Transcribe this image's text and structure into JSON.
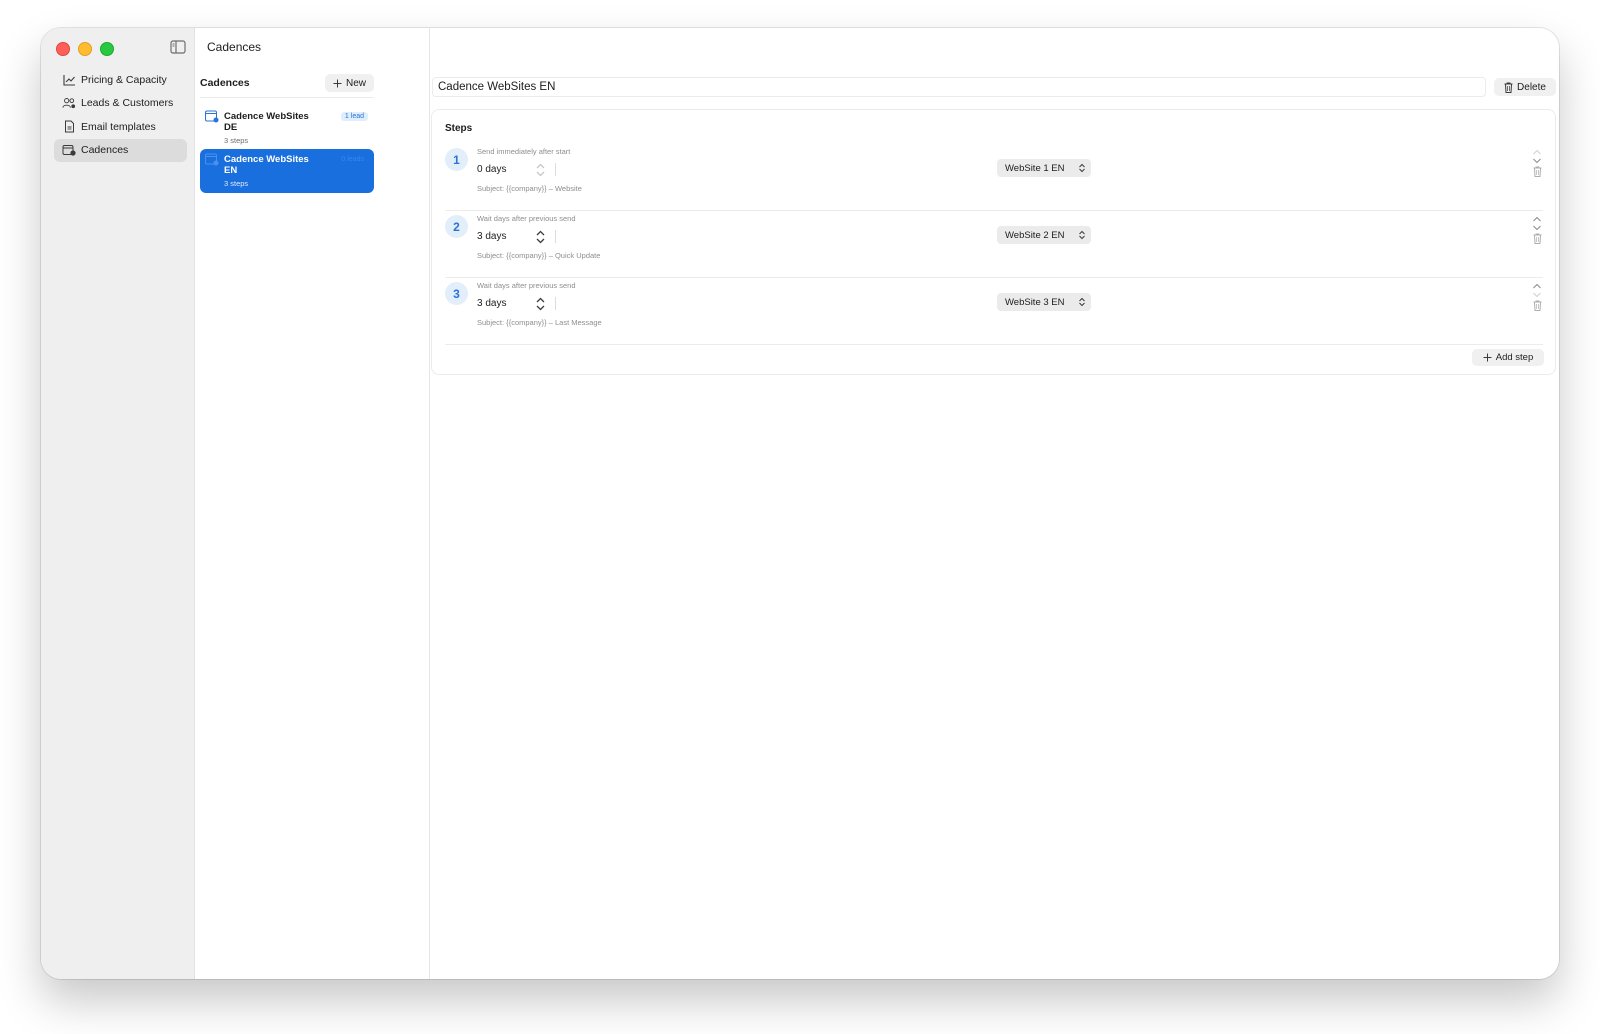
{
  "window": {
    "title": "Cadences"
  },
  "sidebar": {
    "items": [
      {
        "label": "Pricing & Capacity",
        "icon": "chart-icon",
        "active": false
      },
      {
        "label": "Leads & Customers",
        "icon": "people-icon",
        "active": false
      },
      {
        "label": "Email templates",
        "icon": "document-icon",
        "active": false
      },
      {
        "label": "Cadences",
        "icon": "calendar-clock-icon",
        "active": true
      }
    ]
  },
  "list": {
    "title": "Cadences",
    "new_label": "New",
    "items": [
      {
        "name": "Cadence WebSites DE",
        "steps": "3 steps",
        "badge": "1 lead",
        "selected": false
      },
      {
        "name": "Cadence WebSites EN",
        "steps": "3 steps",
        "badge": "0 leads",
        "selected": true
      }
    ]
  },
  "detail": {
    "name": "Cadence WebSites EN",
    "delete_label": "Delete",
    "steps_title": "Steps",
    "add_step_label": "Add step",
    "steps": [
      {
        "number": "1",
        "description": "Send immediately after start",
        "days": "0 days",
        "subject": "Subject: {{company}} – Website",
        "template": "WebSite 1 EN"
      },
      {
        "number": "2",
        "description": "Wait days after previous send",
        "days": "3 days",
        "subject": "Subject: {{company}} – Quick Update",
        "template": "WebSite 2 EN"
      },
      {
        "number": "3",
        "description": "Wait days after previous send",
        "days": "3 days",
        "subject": "Subject: {{company}} – Last Message",
        "template": "WebSite 3 EN"
      }
    ]
  },
  "colors": {
    "accent": "#1a6fde",
    "badge_bg": "#dfeefc",
    "sidebar_bg": "#efefef"
  }
}
